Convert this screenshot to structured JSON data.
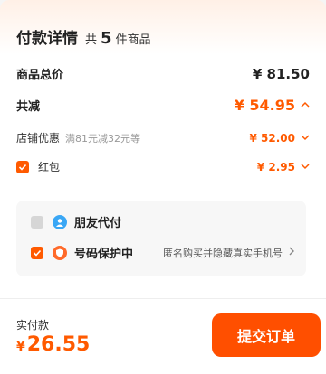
{
  "header": {
    "title": "付款详情",
    "count_prefix": "共",
    "count_num": "5",
    "count_suffix": "件商品"
  },
  "summary": {
    "total_label": "商品总价",
    "total_value": "¥ 81.50",
    "reduce_label": "共减",
    "reduce_value": "¥ 54.95",
    "store_label": "店铺优惠",
    "store_sub": "满81元减32元等",
    "store_value": "¥ 52.00",
    "redpacket_label": "红包",
    "redpacket_value": "¥ 2.95",
    "redpacket_checked": true
  },
  "options": {
    "friend_pay_label": "朋友代付",
    "friend_pay_checked": false,
    "privacy_label": "号码保护中",
    "privacy_checked": true,
    "privacy_hint": "匿名购买并隐藏真实手机号"
  },
  "footer": {
    "pay_label": "实付款",
    "currency": "¥",
    "pay_amount": "26.55",
    "submit_label": "提交订单"
  },
  "colors": {
    "accent": "#ff5a00",
    "button": "#ff4f00"
  }
}
